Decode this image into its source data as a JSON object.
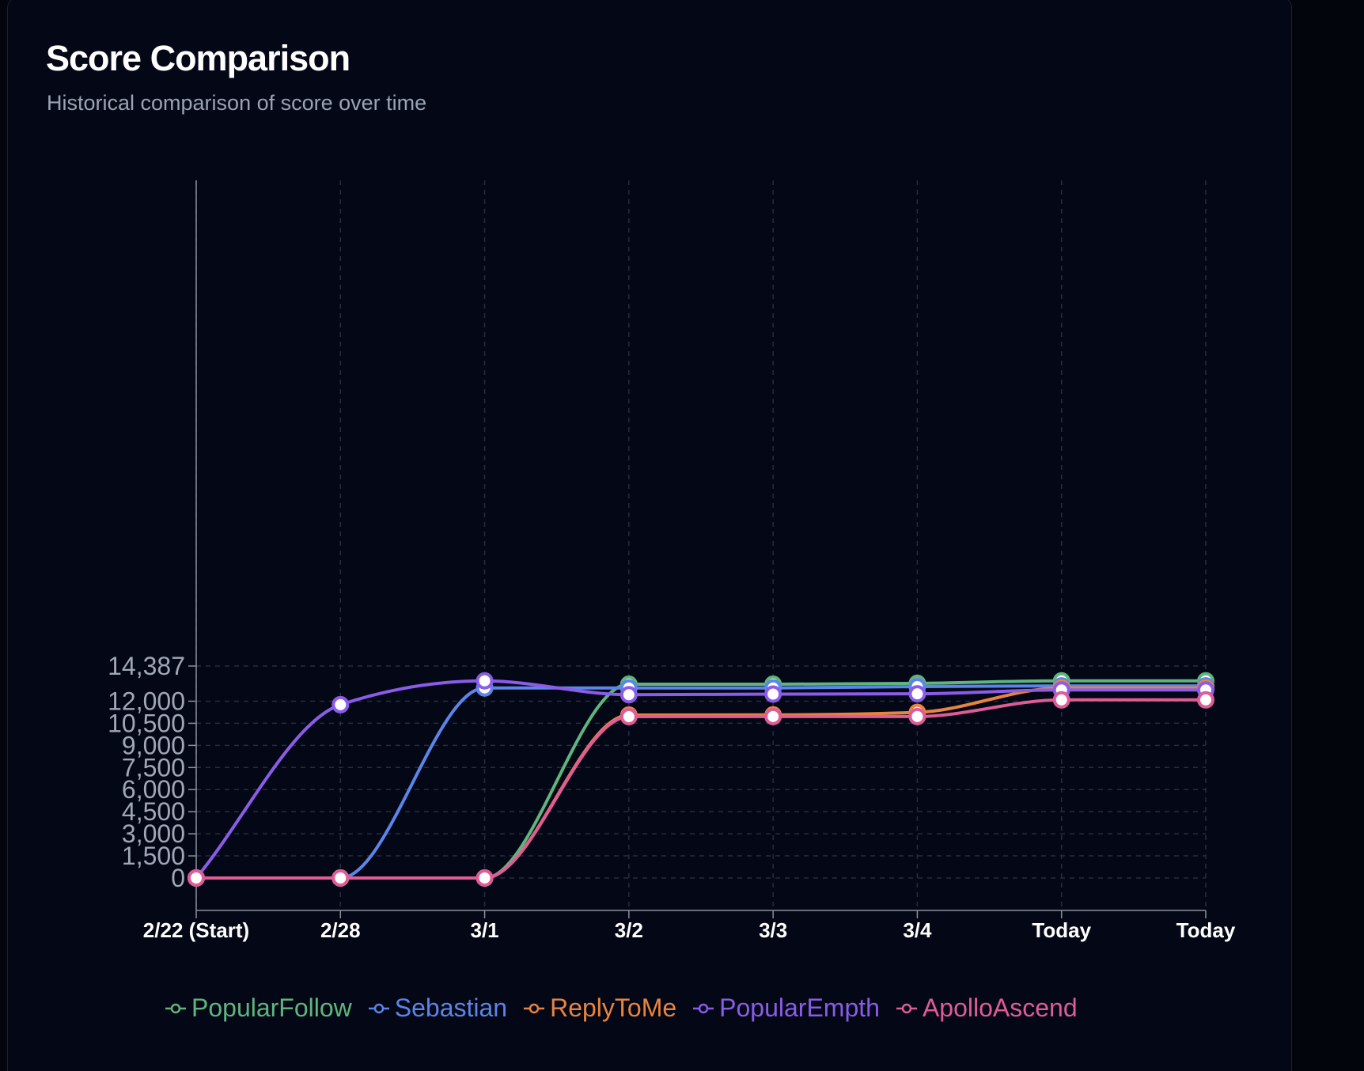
{
  "header": {
    "title": "Score Comparison",
    "subtitle": "Historical comparison of score over time"
  },
  "chart_data": {
    "type": "line",
    "title": "Score Comparison",
    "subtitle": "Historical comparison of score over time",
    "xlabel": "",
    "ylabel": "",
    "categories": [
      "2/22 (Start)",
      "2/28",
      "3/1",
      "3/2",
      "3/3",
      "3/4",
      "Today",
      "Today"
    ],
    "y_ticks": [
      0,
      1500,
      3000,
      4500,
      6000,
      7500,
      9000,
      10500,
      12000,
      14387
    ],
    "y_tick_labels": [
      "0",
      "1,500",
      "3,000",
      "4,500",
      "6,000",
      "7,500",
      "9,000",
      "10,500",
      "12,000",
      "14,387"
    ],
    "ylim": [
      0,
      14387
    ],
    "grid": true,
    "legend_position": "bottom",
    "series": [
      {
        "name": "PopularFollow",
        "color": "#5fb57d",
        "values": [
          0,
          0,
          0,
          13150,
          13150,
          13210,
          13380,
          13380
        ]
      },
      {
        "name": "Sebastian",
        "color": "#5b85e8",
        "values": [
          0,
          0,
          12900,
          12900,
          12900,
          12990,
          13040,
          13040
        ]
      },
      {
        "name": "ReplyToMe",
        "color": "#e8843f",
        "values": [
          0,
          0,
          0,
          11060,
          11070,
          11240,
          12900,
          12900
        ]
      },
      {
        "name": "PopularEmpth",
        "color": "#8a5ce8",
        "values": [
          0,
          11760,
          13380,
          12440,
          12480,
          12500,
          12760,
          12760
        ]
      },
      {
        "name": "ApolloAscend",
        "color": "#df5c96",
        "values": [
          0,
          0,
          0,
          10950,
          10960,
          10960,
          12090,
          12090
        ]
      }
    ]
  }
}
